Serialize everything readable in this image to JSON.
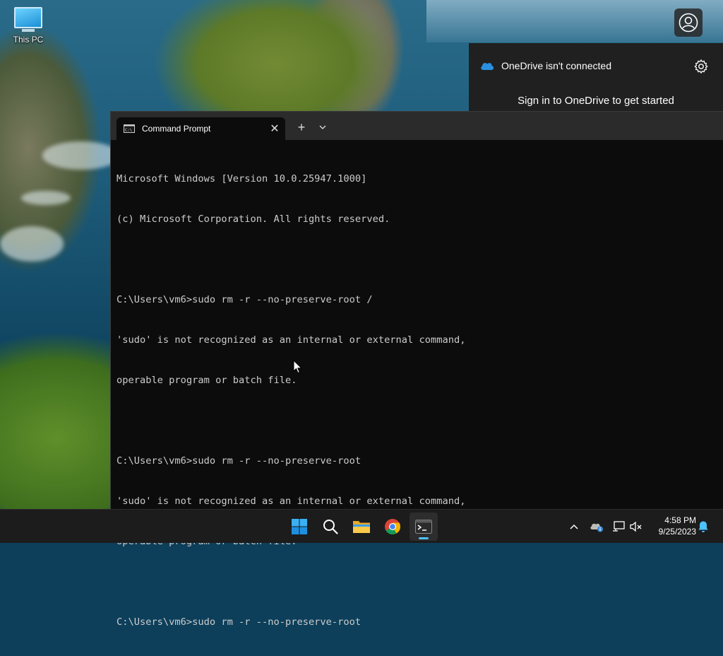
{
  "desktop": {
    "icons": [
      {
        "label": "This PC"
      }
    ]
  },
  "onedrive": {
    "title": "OneDrive isn't connected",
    "signin_text": "Sign in to OneDrive to get started"
  },
  "terminal": {
    "tab_title": "Command Prompt",
    "tab_close_glyph": "✕",
    "new_tab_glyph": "+",
    "lines": [
      "Microsoft Windows [Version 10.0.25947.1000]",
      "(c) Microsoft Corporation. All rights reserved.",
      "",
      "C:\\Users\\vm6>sudo rm -r --no-preserve-root /",
      "'sudo' is not recognized as an internal or external command,",
      "operable program or batch file.",
      "",
      "C:\\Users\\vm6>sudo rm -r --no-preserve-root",
      "'sudo' is not recognized as an internal or external command,",
      "operable program or batch file.",
      "",
      "C:\\Users\\vm6>sudo rm -r --no-preserve-root"
    ]
  },
  "taskbar": {
    "apps": [
      {
        "name": "start",
        "icon": "windows-logo-icon"
      },
      {
        "name": "search",
        "icon": "search-icon"
      },
      {
        "name": "file-explorer",
        "icon": "folder-icon"
      },
      {
        "name": "chrome",
        "icon": "chrome-icon"
      },
      {
        "name": "terminal",
        "icon": "terminal-icon",
        "active": true
      }
    ],
    "tray": {
      "time": "4:58 PM",
      "date": "9/25/2023"
    }
  },
  "colors": {
    "accent": "#4cc2ff",
    "terminal_bg": "#0c0c0c",
    "terminal_text": "#cccccc",
    "taskbar_bg": "#1c1c1c",
    "flyout_bg": "#202020"
  }
}
